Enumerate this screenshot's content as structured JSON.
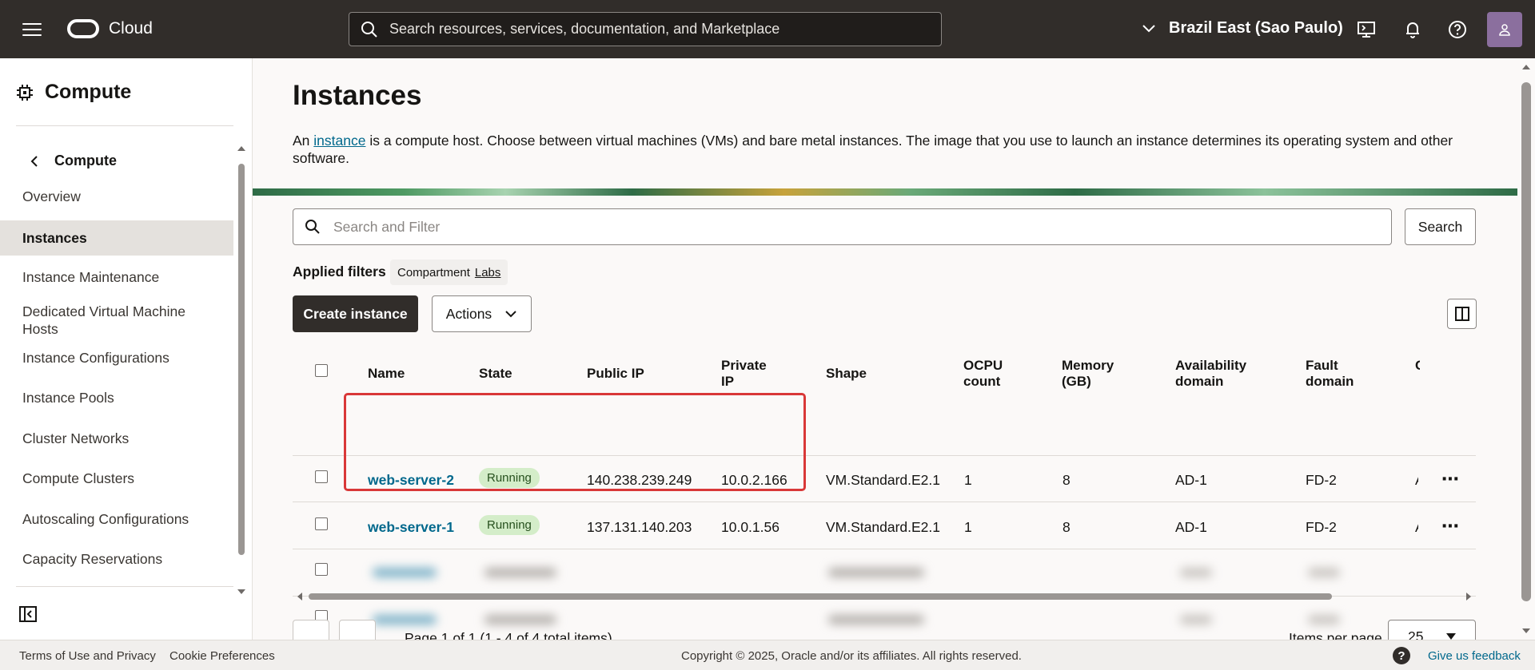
{
  "header": {
    "brand": "Cloud",
    "search_placeholder": "Search resources, services, documentation, and Marketplace",
    "region": "Brazil East (Sao Paulo)"
  },
  "sidebar": {
    "title": "Compute",
    "back_label": "Compute",
    "items": [
      {
        "label": "Overview"
      },
      {
        "label": "Instances",
        "active": true
      },
      {
        "label": "Instance Maintenance"
      },
      {
        "label": "Dedicated Virtual Machine Hosts"
      },
      {
        "label": "Instance Configurations"
      },
      {
        "label": "Instance Pools"
      },
      {
        "label": "Cluster Networks"
      },
      {
        "label": "Compute Clusters"
      },
      {
        "label": "Autoscaling Configurations"
      },
      {
        "label": "Capacity Reservations"
      }
    ]
  },
  "main": {
    "title": "Instances",
    "intro_prefix": "An ",
    "intro_link": "instance",
    "intro_suffix": " is a compute host. Choose between virtual machines (VMs) and bare metal instances. The image that you use to launch an instance determines its operating system and other software.",
    "filter_placeholder": "Search and Filter",
    "search_button": "Search",
    "applied_filters_label": "Applied filters",
    "filter_chip": {
      "key": "Compartment",
      "value": "Labs"
    },
    "create_button": "Create instance",
    "actions_button": "Actions"
  },
  "table": {
    "columns": {
      "name": "Name",
      "state": "State",
      "public_ip": "Public IP",
      "private_ip_1": "Private",
      "private_ip_2": "IP",
      "shape": "Shape",
      "ocpu_1": "OCPU",
      "ocpu_2": "count",
      "memory_1": "Memory",
      "memory_2": "(GB)",
      "ad_1": "Availability",
      "ad_2": "domain",
      "fd_1": "Fault",
      "fd_2": "domain",
      "cut_off": "C"
    },
    "rows": [
      {
        "name": "web-server-2",
        "state": "Running",
        "public_ip": "140.238.239.249",
        "private_ip": "10.0.2.166",
        "shape": "VM.Standard.E2.1",
        "ocpu": "1",
        "memory": "8",
        "ad": "AD-1",
        "fd": "FD-2",
        "cut": "A"
      },
      {
        "name": "web-server-1",
        "state": "Running",
        "public_ip": "137.131.140.203",
        "private_ip": "10.0.1.56",
        "shape": "VM.Standard.E2.1",
        "ocpu": "1",
        "memory": "8",
        "ad": "AD-1",
        "fd": "FD-2",
        "cut": "A"
      }
    ],
    "page_info": "Page 1 of 1 (1 - 4 of 4 total items)",
    "items_per_page_label": "Items per page",
    "items_per_page": "25"
  },
  "footer": {
    "terms": "Terms of Use and Privacy",
    "cookies": "Cookie Preferences",
    "copyright": "Copyright © 2025, Oracle and/or its affiliates. All rights reserved.",
    "feedback": "Give us feedback"
  },
  "colors": {
    "header_bg": "#312d2a",
    "link": "#00688c",
    "running_badge": "#d4edc9",
    "highlight": "#d93838"
  }
}
